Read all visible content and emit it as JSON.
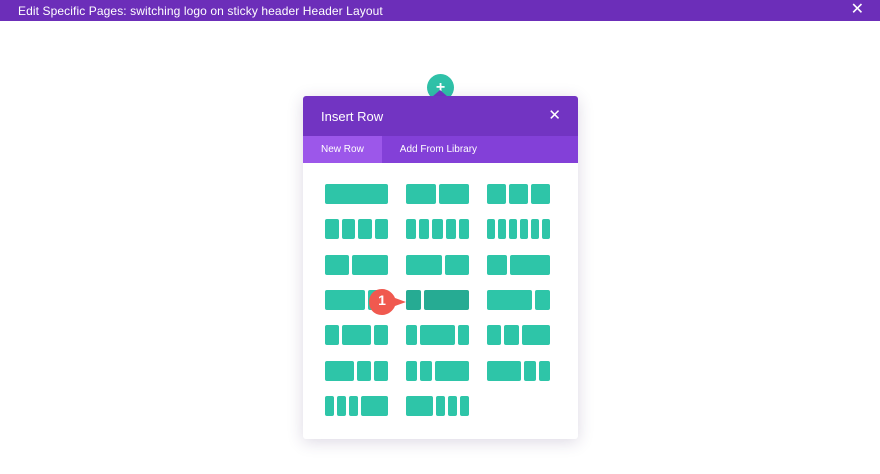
{
  "topbar": {
    "title": "Edit Specific Pages: switching logo on sticky header Header Layout",
    "close_glyph": "✕"
  },
  "add_row_button": {
    "glyph": "+"
  },
  "modal": {
    "title": "Insert Row",
    "close_glyph": "✕",
    "tabs": [
      {
        "label": "New Row",
        "active": true
      },
      {
        "label": "Add From Library",
        "active": false
      }
    ]
  },
  "layouts": [
    {
      "name": "layout-1",
      "cols": [
        1
      ]
    },
    {
      "name": "layout-1-2-1-2",
      "cols": [
        1,
        1
      ]
    },
    {
      "name": "layout-1-3x3",
      "cols": [
        1,
        1,
        1
      ]
    },
    {
      "name": "layout-1-4x4",
      "cols": [
        1,
        1,
        1,
        1
      ]
    },
    {
      "name": "layout-1-5x5",
      "cols": [
        1,
        1,
        1,
        1,
        1
      ]
    },
    {
      "name": "layout-1-6x6",
      "cols": [
        1,
        1,
        1,
        1,
        1,
        1
      ]
    },
    {
      "name": "layout-2-5-3-5",
      "cols": [
        2,
        3
      ]
    },
    {
      "name": "layout-3-5-2-5",
      "cols": [
        3,
        2
      ]
    },
    {
      "name": "layout-1-3-2-3",
      "cols": [
        1,
        2
      ]
    },
    {
      "name": "layout-2-3-1-3",
      "cols": [
        2,
        1
      ]
    },
    {
      "name": "layout-1-4-3-4",
      "cols": [
        1,
        3
      ],
      "hover": true
    },
    {
      "name": "layout-3-4-1-4",
      "cols": [
        3,
        1
      ]
    },
    {
      "name": "layout-1-4-1-2-1-4",
      "cols": [
        1,
        2,
        1
      ]
    },
    {
      "name": "layout-1-5-3-5-1-5",
      "cols": [
        1,
        3,
        1
      ]
    },
    {
      "name": "layout-1-4-1-4-1-2",
      "cols": [
        1,
        1,
        2
      ]
    },
    {
      "name": "layout-1-2-1-4-1-4",
      "cols": [
        2,
        1,
        1
      ]
    },
    {
      "name": "layout-1-5-1-5-3-5",
      "cols": [
        1,
        1,
        3
      ]
    },
    {
      "name": "layout-3-5-1-5-1-5",
      "cols": [
        3,
        1,
        1
      ]
    },
    {
      "name": "layout-1-6x3-1-2",
      "cols": [
        1,
        1,
        1,
        3
      ]
    },
    {
      "name": "layout-1-2-1-6x3",
      "cols": [
        3,
        1,
        1,
        1
      ]
    }
  ],
  "step_marker": {
    "number": "1",
    "color": "#f0594f"
  },
  "colors": {
    "purple_dark": "#6c2eb9",
    "purple": "#7234c2",
    "purple_tabs": "#8340d8",
    "teal": "#2ec5a8"
  }
}
